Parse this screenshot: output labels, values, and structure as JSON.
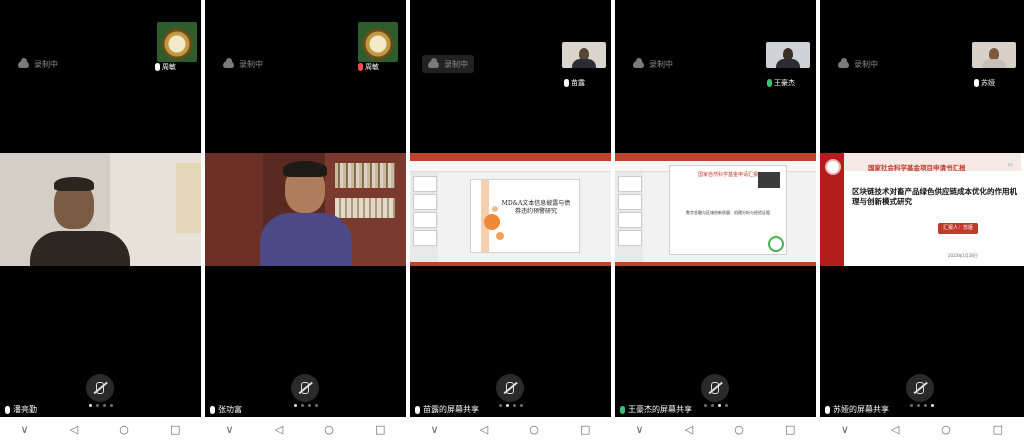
{
  "recording_label": "录制中",
  "panels": [
    {
      "top_user": "周敏",
      "bottom_user": "潘亮勤",
      "page_dots": [
        true,
        false,
        false,
        false
      ]
    },
    {
      "top_user": "周敏",
      "bottom_user": "张功富",
      "page_dots": [
        true,
        false,
        false,
        false
      ]
    },
    {
      "top_user": "苗露",
      "bottom_user": "苗露的屏幕共享",
      "page_dots": [
        false,
        true,
        false,
        false
      ],
      "slide": {
        "title": "MD&A文本信息披露与债券违约预警研究"
      }
    },
    {
      "top_user": "王豪杰",
      "bottom_user": "王豪杰的屏幕共享",
      "page_dots": [
        false,
        false,
        true,
        false
      ],
      "slide": {
        "title": "国家自然科学基金申请汇报",
        "line": "数字金融与区域创新质量：机理分析与经验证据"
      }
    },
    {
      "top_user": "苏娅",
      "bottom_user": "苏娅的屏幕共享",
      "page_dots": [
        false,
        false,
        false,
        true
      ],
      "slide": {
        "header": "国家社会科学基金项目申请书汇报",
        "main": "区块链技术对畜产品绿色供应链成本优化的作用机理与创新模式研究",
        "reporter": "汇报人：苏娅",
        "date": "2023年2月28日"
      }
    }
  ],
  "nav": {
    "down": "∨",
    "back": "◁",
    "home": "○",
    "recent": "□"
  }
}
